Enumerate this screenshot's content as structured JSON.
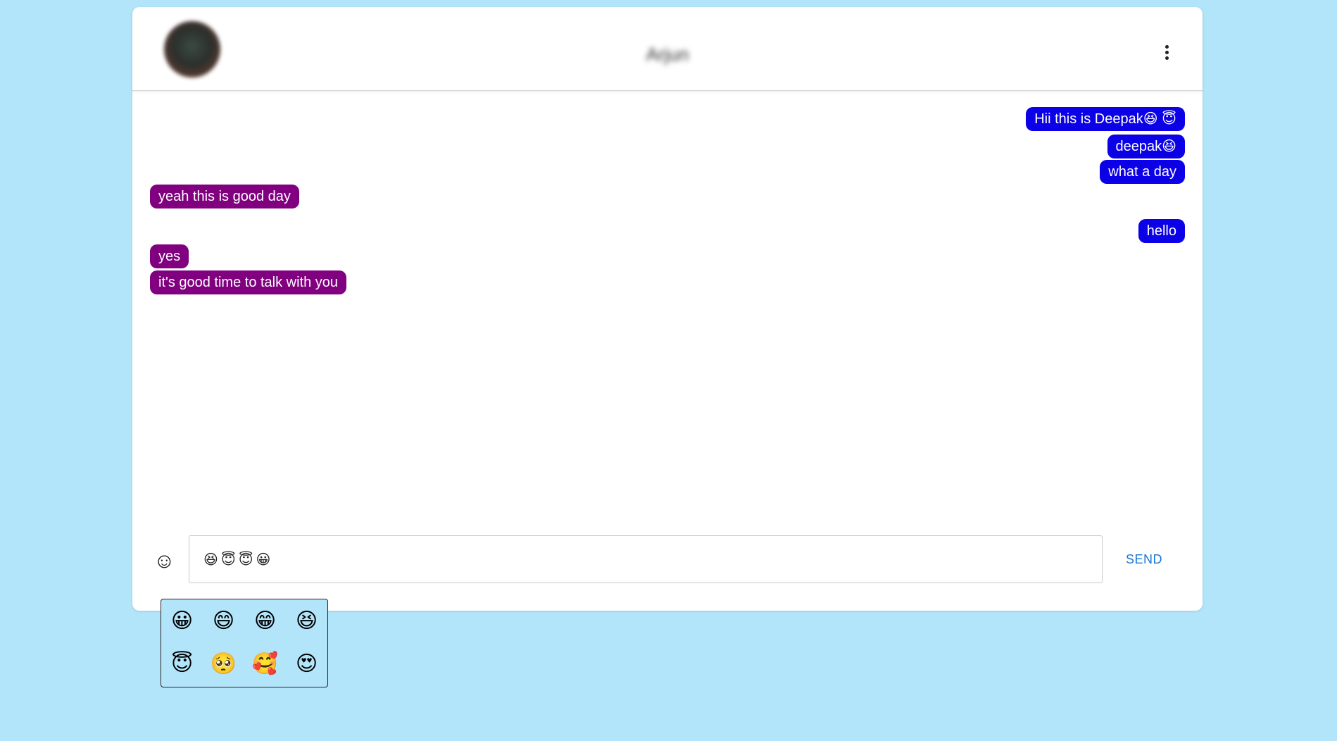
{
  "header": {
    "contact_name": "Arjun",
    "avatar_icon": "avatar-image",
    "menu_icon": "more-vert-icon"
  },
  "messages": [
    {
      "text": "Hii this is Deepak😆 😇",
      "type": "sent"
    },
    {
      "text": "deepak😆",
      "type": "sent"
    },
    {
      "text": "what a day",
      "type": "sent"
    },
    {
      "text": "yeah this is good day",
      "type": "received"
    },
    {
      "text": "hello",
      "type": "sent"
    },
    {
      "text": "yes",
      "type": "received"
    },
    {
      "text": "it's good time to talk with you",
      "type": "received"
    }
  ],
  "composer": {
    "emoji_toggle_icon": "☺",
    "input_value": "😆😇😇😀",
    "send_label": "SEND"
  },
  "emoji_picker": {
    "emojis": [
      "😀",
      "😄",
      "😁",
      "😆",
      "😇",
      "🥺",
      "🥰",
      "😍"
    ]
  },
  "colors": {
    "background": "#b3e5fa",
    "sent_bubble": "#0b00e6",
    "received_bubble": "#800080",
    "send_button": "#1976d2"
  }
}
